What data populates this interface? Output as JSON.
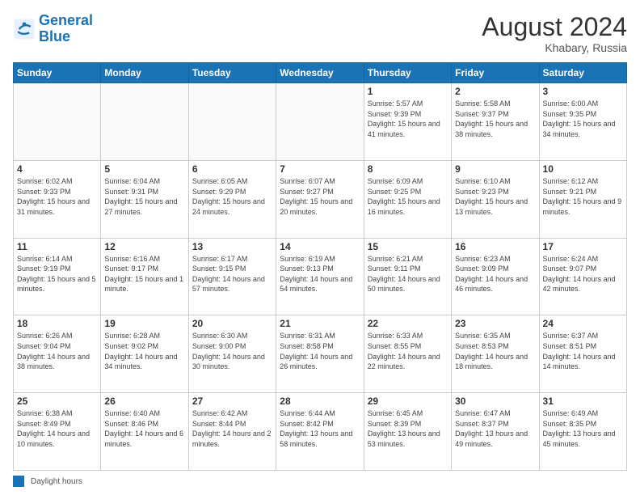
{
  "logo": {
    "line1": "General",
    "line2": "Blue"
  },
  "header": {
    "month": "August 2024",
    "location": "Khabary, Russia"
  },
  "days_of_week": [
    "Sunday",
    "Monday",
    "Tuesday",
    "Wednesday",
    "Thursday",
    "Friday",
    "Saturday"
  ],
  "legend": {
    "label": "Daylight hours"
  },
  "weeks": [
    [
      {
        "day": "",
        "info": ""
      },
      {
        "day": "",
        "info": ""
      },
      {
        "day": "",
        "info": ""
      },
      {
        "day": "",
        "info": ""
      },
      {
        "day": "1",
        "info": "Sunrise: 5:57 AM\nSunset: 9:39 PM\nDaylight: 15 hours\nand 41 minutes."
      },
      {
        "day": "2",
        "info": "Sunrise: 5:58 AM\nSunset: 9:37 PM\nDaylight: 15 hours\nand 38 minutes."
      },
      {
        "day": "3",
        "info": "Sunrise: 6:00 AM\nSunset: 9:35 PM\nDaylight: 15 hours\nand 34 minutes."
      }
    ],
    [
      {
        "day": "4",
        "info": "Sunrise: 6:02 AM\nSunset: 9:33 PM\nDaylight: 15 hours\nand 31 minutes."
      },
      {
        "day": "5",
        "info": "Sunrise: 6:04 AM\nSunset: 9:31 PM\nDaylight: 15 hours\nand 27 minutes."
      },
      {
        "day": "6",
        "info": "Sunrise: 6:05 AM\nSunset: 9:29 PM\nDaylight: 15 hours\nand 24 minutes."
      },
      {
        "day": "7",
        "info": "Sunrise: 6:07 AM\nSunset: 9:27 PM\nDaylight: 15 hours\nand 20 minutes."
      },
      {
        "day": "8",
        "info": "Sunrise: 6:09 AM\nSunset: 9:25 PM\nDaylight: 15 hours\nand 16 minutes."
      },
      {
        "day": "9",
        "info": "Sunrise: 6:10 AM\nSunset: 9:23 PM\nDaylight: 15 hours\nand 13 minutes."
      },
      {
        "day": "10",
        "info": "Sunrise: 6:12 AM\nSunset: 9:21 PM\nDaylight: 15 hours\nand 9 minutes."
      }
    ],
    [
      {
        "day": "11",
        "info": "Sunrise: 6:14 AM\nSunset: 9:19 PM\nDaylight: 15 hours\nand 5 minutes."
      },
      {
        "day": "12",
        "info": "Sunrise: 6:16 AM\nSunset: 9:17 PM\nDaylight: 15 hours\nand 1 minute."
      },
      {
        "day": "13",
        "info": "Sunrise: 6:17 AM\nSunset: 9:15 PM\nDaylight: 14 hours\nand 57 minutes."
      },
      {
        "day": "14",
        "info": "Sunrise: 6:19 AM\nSunset: 9:13 PM\nDaylight: 14 hours\nand 54 minutes."
      },
      {
        "day": "15",
        "info": "Sunrise: 6:21 AM\nSunset: 9:11 PM\nDaylight: 14 hours\nand 50 minutes."
      },
      {
        "day": "16",
        "info": "Sunrise: 6:23 AM\nSunset: 9:09 PM\nDaylight: 14 hours\nand 46 minutes."
      },
      {
        "day": "17",
        "info": "Sunrise: 6:24 AM\nSunset: 9:07 PM\nDaylight: 14 hours\nand 42 minutes."
      }
    ],
    [
      {
        "day": "18",
        "info": "Sunrise: 6:26 AM\nSunset: 9:04 PM\nDaylight: 14 hours\nand 38 minutes."
      },
      {
        "day": "19",
        "info": "Sunrise: 6:28 AM\nSunset: 9:02 PM\nDaylight: 14 hours\nand 34 minutes."
      },
      {
        "day": "20",
        "info": "Sunrise: 6:30 AM\nSunset: 9:00 PM\nDaylight: 14 hours\nand 30 minutes."
      },
      {
        "day": "21",
        "info": "Sunrise: 6:31 AM\nSunset: 8:58 PM\nDaylight: 14 hours\nand 26 minutes."
      },
      {
        "day": "22",
        "info": "Sunrise: 6:33 AM\nSunset: 8:55 PM\nDaylight: 14 hours\nand 22 minutes."
      },
      {
        "day": "23",
        "info": "Sunrise: 6:35 AM\nSunset: 8:53 PM\nDaylight: 14 hours\nand 18 minutes."
      },
      {
        "day": "24",
        "info": "Sunrise: 6:37 AM\nSunset: 8:51 PM\nDaylight: 14 hours\nand 14 minutes."
      }
    ],
    [
      {
        "day": "25",
        "info": "Sunrise: 6:38 AM\nSunset: 8:49 PM\nDaylight: 14 hours\nand 10 minutes."
      },
      {
        "day": "26",
        "info": "Sunrise: 6:40 AM\nSunset: 8:46 PM\nDaylight: 14 hours\nand 6 minutes."
      },
      {
        "day": "27",
        "info": "Sunrise: 6:42 AM\nSunset: 8:44 PM\nDaylight: 14 hours\nand 2 minutes."
      },
      {
        "day": "28",
        "info": "Sunrise: 6:44 AM\nSunset: 8:42 PM\nDaylight: 13 hours\nand 58 minutes."
      },
      {
        "day": "29",
        "info": "Sunrise: 6:45 AM\nSunset: 8:39 PM\nDaylight: 13 hours\nand 53 minutes."
      },
      {
        "day": "30",
        "info": "Sunrise: 6:47 AM\nSunset: 8:37 PM\nDaylight: 13 hours\nand 49 minutes."
      },
      {
        "day": "31",
        "info": "Sunrise: 6:49 AM\nSunset: 8:35 PM\nDaylight: 13 hours\nand 45 minutes."
      }
    ]
  ]
}
